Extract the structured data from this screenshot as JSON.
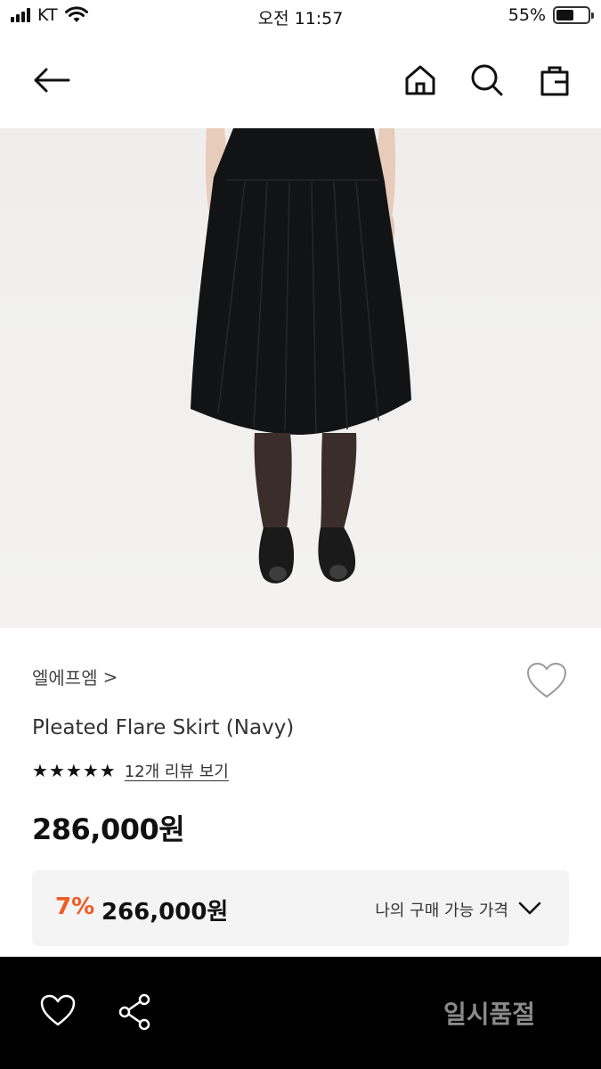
{
  "status_bar": {
    "carrier": "KT",
    "time": "오전 11:57",
    "battery": "55%",
    "battery_level": 0.55
  },
  "nav": {
    "back_icon": "arrow-left-icon",
    "home_icon": "home-icon",
    "search_icon": "search-icon",
    "cart_icon": "shopping-bag-icon"
  },
  "product": {
    "brand": "엘에프엠",
    "brand_chevron": ">",
    "name": "Pleated Flare Skirt (Navy)",
    "rating": 5,
    "rating_max": 5,
    "review_link": "12개 리뷰 보기",
    "price": "286,000원"
  },
  "my_price": {
    "discount": "7%",
    "amount": "266,000원",
    "label": "나의 구매 가능 가격"
  },
  "bottom_bar": {
    "soldout_label": "일시품절"
  },
  "colors": {
    "accent_discount": "#f15a24",
    "bottom_bar_bg": "#000000",
    "soldout_text": "#8a8a8a"
  }
}
